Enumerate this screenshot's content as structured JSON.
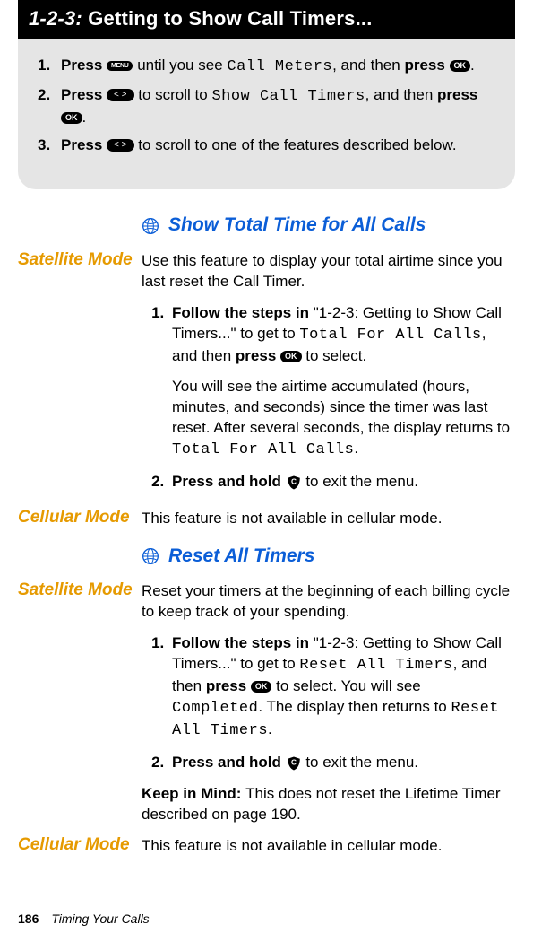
{
  "box": {
    "title_prefix": "1-2-3:",
    "title_rest": "Getting to Show Call Timers...",
    "steps": [
      {
        "n": "1.",
        "pre": "Press ",
        "post_a": " until you see ",
        "lcd": "Call Meters",
        "post_b": ", and then ",
        "bold": "press ",
        "post_c": "."
      },
      {
        "n": "2.",
        "pre": "Press ",
        "post_a": " to scroll to ",
        "lcd": "Show Call Timers",
        "post_b": ", and then ",
        "bold": "press ",
        "post_c": "."
      },
      {
        "n": "3.",
        "pre": "Press ",
        "post_a": " to scroll to one of the features described below."
      }
    ]
  },
  "sec1": {
    "title": "Show Total Time for All Calls",
    "sat_label": "Satellite Mode",
    "sat_intro": "Use this feature to display your total airtime since you last reset the Call Timer.",
    "s1a": "Follow the steps in ",
    "s1b": "\"1-2-3: Getting to Show Call Timers...\" to get to ",
    "s1_lcd": "Total For All Calls",
    "s1c": ", and then ",
    "s1_bold": "press ",
    "s1d": " to select.",
    "s1_para": "You will see the airtime accumulated (hours, minutes, and seconds) since the timer was last reset. After several seconds, the display returns to ",
    "s1_para_lcd": "Total For All Calls",
    "s1_para_end": ".",
    "s2_bold": "Press and hold ",
    "s2_end": " to exit the menu.",
    "cel_label": "Cellular Mode",
    "cel_text": "This feature is not available in cellular mode."
  },
  "sec2": {
    "title": "Reset All Timers",
    "sat_label": "Satellite Mode",
    "sat_intro": "Reset your timers at the beginning of each billing cycle to keep track of your spending.",
    "s1a": "Follow the steps in ",
    "s1b": "\"1-2-3: Getting to Show Call Timers...\" to get to ",
    "s1_lcd": "Reset All Timers",
    "s1c": ", and then ",
    "s1_bold": "press ",
    "s1d": " to select. You will see ",
    "s1_lcd2": "Completed",
    "s1e": ". The display then returns to ",
    "s1_lcd3": "Reset All Timers",
    "s1f": ".",
    "s2_bold": "Press and hold ",
    "s2_end": " to exit the menu.",
    "kim_bold": "Keep in Mind: ",
    "kim_text": "This does not reset the Lifetime Timer described on page 190.",
    "cel_label": "Cellular Mode",
    "cel_text": "This feature is not available in cellular mode."
  },
  "footer": {
    "page": "186",
    "section": "Timing Your Calls"
  },
  "keys": {
    "menu": "MENU",
    "ok": "OK",
    "c": "C"
  }
}
